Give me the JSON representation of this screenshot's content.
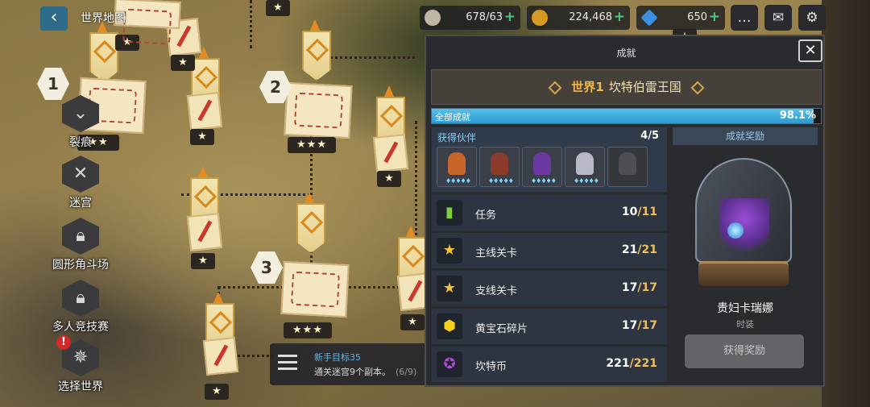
{
  "topbar": {
    "title": "世界地图",
    "resources": [
      {
        "name": "coffee-icon",
        "value": "678/63"
      },
      {
        "name": "gold-coin-icon",
        "value": "224,468"
      },
      {
        "name": "gem-icon",
        "value": "650"
      }
    ]
  },
  "map": {
    "stage_numbers": [
      "1",
      "2",
      "3"
    ],
    "star_tags": [
      "★",
      "★",
      "★",
      "★",
      "★",
      "★",
      "★",
      "★",
      "★"
    ],
    "star3_tags": [
      "★★★",
      "★★★",
      "★★★",
      "★★"
    ]
  },
  "left_menu": [
    {
      "label": "裂痕",
      "icon": "rift-icon"
    },
    {
      "label": "迷宫",
      "icon": "crossed-swords-icon"
    },
    {
      "label": "圆形角斗场",
      "icon": "locked-icon"
    },
    {
      "label": "多人竞技赛",
      "icon": "locked-icon"
    },
    {
      "label": "选择世界",
      "icon": "compass-icon",
      "alert": "!"
    }
  ],
  "quest": {
    "title": "新手目标35",
    "desc": "通关迷宫9个副本。",
    "progress": "(6/9)"
  },
  "panel": {
    "title": "成就",
    "close": "✕",
    "world_num": "世界1",
    "world_name": "坎特伯雷王国",
    "total_label": "全部成就",
    "total_pct": "98.1%",
    "total_value": 98.1,
    "partners_label": "获得伙伴",
    "partners_count": "4/5",
    "portraits": [
      {
        "color": "#c7652a",
        "lv": "♦♦♦♦♦"
      },
      {
        "color": "#8a3b2a",
        "lv": "♦♦♦♦♦"
      },
      {
        "color": "#6b3aa0",
        "lv": "♦♦♦♦♦"
      },
      {
        "color": "#b8b8c8",
        "lv": "♦♦♦♦♦"
      }
    ],
    "achievements": [
      {
        "name": "任务",
        "done": "10",
        "total": "/11",
        "icon": "bookmark-icon",
        "color": "#7ed13a"
      },
      {
        "name": "主线关卡",
        "done": "21",
        "total": "/21",
        "icon": "three-stars-icon",
        "color": "#f4c430"
      },
      {
        "name": "支线关卡",
        "done": "17",
        "total": "/17",
        "icon": "star-icon",
        "color": "#f4c430"
      },
      {
        "name": "黄宝石碎片",
        "done": "17",
        "total": "/17",
        "icon": "yellow-gem-icon",
        "color": "#f5d318"
      },
      {
        "name": "坎特币",
        "done": "221",
        "total": "/221",
        "icon": "purple-coin-icon",
        "color": "#b14ad8"
      }
    ],
    "reward_label": "成就奖励",
    "reward_name": "贵妇卡瑞娜",
    "reward_type": "时装",
    "claim_label": "获得奖励"
  }
}
